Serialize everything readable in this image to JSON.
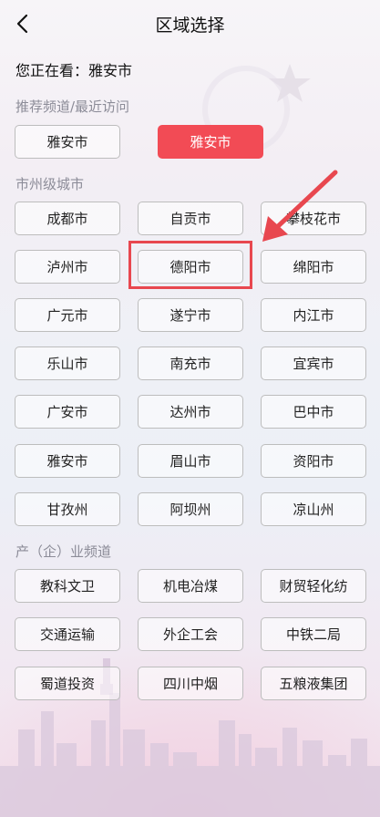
{
  "header": {
    "title": "区域选择"
  },
  "current": {
    "prefix": "您正在看：",
    "city": "雅安市"
  },
  "recommended": {
    "title": "推荐频道/最近访问",
    "items": [
      "雅安市",
      "雅安市"
    ]
  },
  "cities": {
    "title": "市州级城市",
    "items": [
      "成都市",
      "自贡市",
      "攀枝花市",
      "泸州市",
      "德阳市",
      "绵阳市",
      "广元市",
      "遂宁市",
      "内江市",
      "乐山市",
      "南充市",
      "宜宾市",
      "广安市",
      "达州市",
      "巴中市",
      "雅安市",
      "眉山市",
      "资阳市",
      "甘孜州",
      "阿坝州",
      "凉山州"
    ]
  },
  "industry": {
    "title": "产（企）业频道",
    "items": [
      "教科文卫",
      "机电冶煤",
      "财贸轻化纺",
      "交通运输",
      "外企工会",
      "中铁二局",
      "蜀道投资",
      "四川中烟",
      "五粮液集团"
    ]
  },
  "colors": {
    "accent": "#f24b55",
    "highlight": "#e8474f"
  }
}
